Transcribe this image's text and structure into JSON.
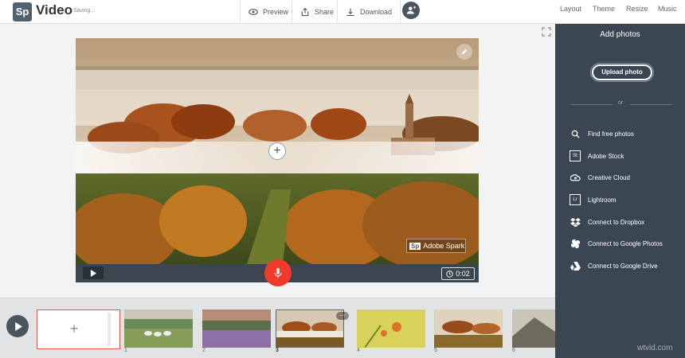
{
  "app": {
    "logo": "Sp",
    "title": "Video",
    "status": "Saving..."
  },
  "toolbar": {
    "preview": "Preview",
    "share": "Share",
    "download": "Download"
  },
  "right_menu": {
    "layout": "Layout",
    "theme": "Theme",
    "resize": "Resize",
    "music": "Music"
  },
  "slide": {
    "watermark": "Adobe Spark",
    "watermark_logo": "Sp",
    "duration": "0:02"
  },
  "sidebar": {
    "title": "Add photos",
    "upload": "Upload photo",
    "or": "or",
    "options": [
      {
        "label": "Find free photos",
        "icon": "search-icon"
      },
      {
        "label": "Adobe Stock",
        "icon": "adobe-stock-icon",
        "glyph": "St"
      },
      {
        "label": "Creative Cloud",
        "icon": "creative-cloud-icon"
      },
      {
        "label": "Lightroom",
        "icon": "lightroom-icon",
        "glyph": "Lr"
      },
      {
        "label": "Connect to Dropbox",
        "icon": "dropbox-icon"
      },
      {
        "label": "Connect to Google Photos",
        "icon": "google-photos-icon"
      },
      {
        "label": "Connect to Google Drive",
        "icon": "google-drive-icon"
      }
    ]
  },
  "timeline": {
    "add": "+",
    "numbers": [
      "1",
      "2",
      "3",
      "4",
      "5",
      "6"
    ],
    "more": "..."
  },
  "site_watermark": "wtvid.com",
  "colors": {
    "accent": "#ee3b2b",
    "sidebar": "#3a4652",
    "selected_border": "#e05a4b"
  }
}
